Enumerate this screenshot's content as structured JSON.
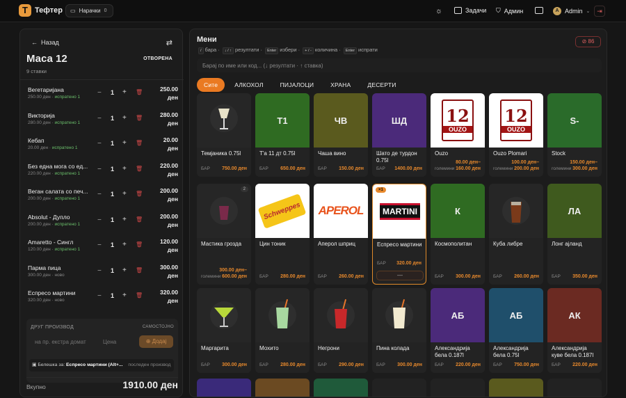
{
  "app": {
    "name": "Тефтер",
    "logo": "T",
    "orders_label": "Нарачки",
    "orders_count": "0"
  },
  "topbar": {
    "theme_icon": "sun-icon",
    "tasks": "Задачи",
    "admin_mode": "Админ",
    "user": "Admin",
    "avatar": "A"
  },
  "left": {
    "back": "Назад",
    "table": "Маса 12",
    "status": "ОТВОРЕНА",
    "count": "9 ставки",
    "items": [
      {
        "name": "Вегетаријана",
        "sub": "250.00 ден",
        "state": "испратено 1",
        "qty": "1",
        "price": "250.00",
        "cur": "ден"
      },
      {
        "name": "Викторија",
        "sub": "280.00 ден",
        "state": "испратено 1",
        "qty": "1",
        "price": "280.00",
        "cur": "ден"
      },
      {
        "name": "Кебап",
        "sub": "20.00 ден",
        "state": "испратено 1",
        "qty": "1",
        "price": "20.00",
        "cur": "ден"
      },
      {
        "name": "Без една мога со ед...",
        "sub": "220.00 ден",
        "state": "испратено 1",
        "qty": "1",
        "price": "220.00",
        "cur": "ден"
      },
      {
        "name": "Веган салата со печ...",
        "sub": "200.00 ден",
        "state": "испратено 1",
        "qty": "1",
        "price": "200.00",
        "cur": "ден"
      },
      {
        "name": "Absolut - Дупло",
        "sub": "200.00 ден",
        "state": "испратено 1",
        "qty": "1",
        "price": "200.00",
        "cur": "ден"
      },
      {
        "name": "Amaretto - Сингл",
        "sub": "120.00 ден",
        "state": "испратено 1",
        "qty": "1",
        "price": "120.00",
        "cur": "ден"
      },
      {
        "name": "Парма пица",
        "sub": "300.00 ден",
        "state": "ново",
        "qty": "1",
        "price": "300.00",
        "cur": "ден"
      },
      {
        "name": "Еспресо мартини",
        "sub": "320.00 ден",
        "state": "ново",
        "qty": "1",
        "price": "320.00",
        "cur": "ден"
      }
    ],
    "other_label": "ДРУГ ПРОИЗВОД",
    "other_right": "САМОСТОЈНО",
    "other_name_placeholder": "на пр. екстра домат",
    "other_price_placeholder": "Цена",
    "add": "Додај",
    "note_prefix": "Белешка за:",
    "note_item": "Еспресо мартини (Alt+...",
    "note_last": "последен производ",
    "total_label": "Вкупно",
    "total": "1910.00 ден"
  },
  "menu": {
    "title": "Мени",
    "hint_search": "бара",
    "hint_results": "резултати",
    "hint_select": "избери",
    "hint_qty": "количина",
    "hint_send": "испрати",
    "kbd_slash": "/",
    "kbd_arrows": "↓ / ↑",
    "kbd_enter": "Enter",
    "kbd_plusminus": "+ / -",
    "kbd_enter2": "Enter",
    "badge": "86",
    "search_placeholder": "Барај по име или код... (↓ резултати · ↑ ставка)",
    "tabs": [
      "Сите",
      "АЛКОХОЛ",
      "ПИЈАЛОЦИ",
      "ХРАНА",
      "ДЕСЕРТИ"
    ],
    "cards": [
      {
        "name": "Темјаника 0.75l",
        "bar": "БАР",
        "price": "750.00 ден",
        "img": "wine-glass-icon",
        "bg": "#262626"
      },
      {
        "name": "Т'а 11 дт 0.75l",
        "bar": "БАР",
        "price": "650.00 ден",
        "img": "Т1",
        "bg": "#2f6b22"
      },
      {
        "name": "Чаша вино",
        "bar": "БАР",
        "price": "150.00 ден",
        "img": "ЧВ",
        "bg": "#5a5a1e"
      },
      {
        "name": "Шато де турдон 0.75l",
        "bar": "БАР",
        "price": "1400.00 ден",
        "img": "ШД",
        "bg": "#4b2a7a"
      },
      {
        "name": "Ouzo",
        "bar": "големини",
        "price": "80.00 ден–160.00 ден",
        "img": "ouzo",
        "bg": "#ffffff"
      },
      {
        "name": "Ouzo Plomari",
        "bar": "големини",
        "price": "100.00 ден–200.00 ден",
        "img": "ouzo",
        "bg": "#ffffff"
      },
      {
        "name": "Stock",
        "bar": "големини",
        "price": "150.00 ден–300.00 ден",
        "img": "S-",
        "bg": "#2a6b2a"
      },
      {
        "name": "Мастика грозда",
        "bar": "големини",
        "price": "300.00 ден–600.00 ден",
        "img": "shot-glass-icon",
        "bg": "#262626",
        "chip2": "2"
      },
      {
        "name": "Цин тоник",
        "bar": "БАР",
        "price": "280.00 ден",
        "img": "Schweppes",
        "bg": "#ffffff"
      },
      {
        "name": "Аперол шприц",
        "bar": "БАР",
        "price": "260.00 ден",
        "img": "APEROL",
        "bg": "#ffffff"
      },
      {
        "name": "Еспресо мартини",
        "bar": "БАР",
        "price": "320.00 ден",
        "img": "MARTINI",
        "bg": "#ffffff",
        "chip": "×1",
        "ctl": "—"
      },
      {
        "name": "Космополитан",
        "bar": "БАР",
        "price": "300.00 ден",
        "img": "К",
        "bg": "#2f6b22"
      },
      {
        "name": "Куба либре",
        "bar": "БАР",
        "price": "260.00 ден",
        "img": "tall-glass-icon",
        "bg": "#262626"
      },
      {
        "name": "Лонг ајланд",
        "bar": "БАР",
        "price": "350.00 ден",
        "img": "ЛА",
        "bg": "#3f5a1e"
      },
      {
        "name": "Маргарита",
        "bar": "БАР",
        "price": "300.00 ден",
        "img": "margarita-icon",
        "bg": "#262626"
      },
      {
        "name": "Мохито",
        "bar": "БАР",
        "price": "280.00 ден",
        "img": "mojito-icon",
        "bg": "#262626"
      },
      {
        "name": "Негрони",
        "bar": "БАР",
        "price": "290.00 ден",
        "img": "negroni-icon",
        "bg": "#262626"
      },
      {
        "name": "Пина колада",
        "bar": "БАР",
        "price": "300.00 ден",
        "img": "pina-icon",
        "bg": "#262626"
      },
      {
        "name": "Александрија бела 0.187l",
        "bar": "БАР",
        "price": "220.00 ден",
        "img": "АБ",
        "bg": "#4b2a7a"
      },
      {
        "name": "Александрија бела 0.75l",
        "bar": "БАР",
        "price": "750.00 ден",
        "img": "АБ",
        "bg": "#1f4f6b"
      },
      {
        "name": "Александрија куве бела 0.187l",
        "bar": "БАР",
        "price": "220.00 ден",
        "img": "АК",
        "bg": "#6b2a22"
      }
    ]
  },
  "colors": {
    "accent": "#ea7a22",
    "sent": "#6bbf6b",
    "danger": "#d04848"
  }
}
